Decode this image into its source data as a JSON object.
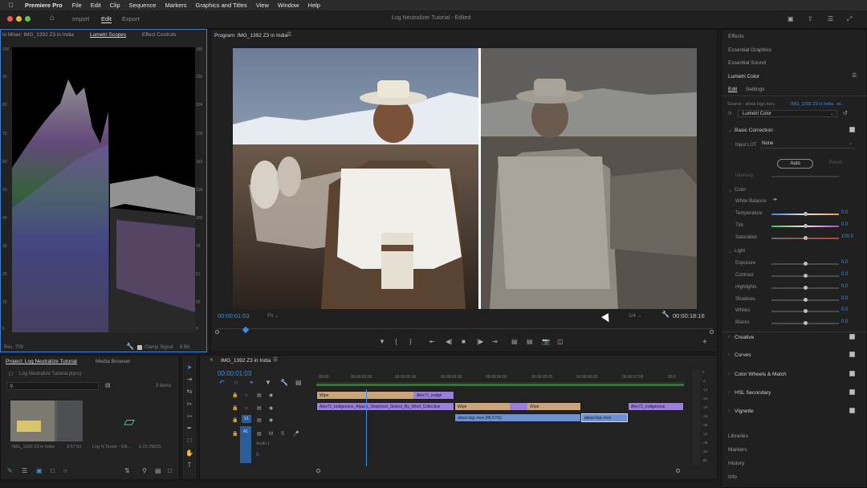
{
  "menubar": {
    "app_name": "Premiere Pro",
    "items": [
      "File",
      "Edit",
      "Clip",
      "Sequence",
      "Markers",
      "Graphics and Titles",
      "View",
      "Window",
      "Help"
    ]
  },
  "titlebar": {
    "nav": [
      "Import",
      "Edit",
      "Export"
    ],
    "title": "Log Neutralizer Tutorial",
    "edited": "- Edited"
  },
  "scopes": {
    "tabs": [
      "io Mixer: IMG_1392 Z3 in India",
      "Lumetri Scopes",
      "Effect Controls"
    ],
    "left_scale": [
      "100",
      "90",
      "80",
      "70",
      "60",
      "50",
      "40",
      "30",
      "20",
      "10",
      "0"
    ],
    "right_scale": [
      "255",
      "230",
      "204",
      "178",
      "153",
      "128",
      "102",
      "76",
      "51",
      "26",
      "0"
    ],
    "footer_left": "Rec. 709",
    "clamp_label": "Clamp Signal",
    "bit_depth": "8 Bit"
  },
  "program": {
    "title": "Program: IMG_1392 Z3 in India",
    "timecode": "00:00:01:03",
    "fit": "Fit",
    "quality": "1/4",
    "duration": "00:00:18:16"
  },
  "project": {
    "tabs": [
      "Project: Log Neutralize Tutorial",
      "Media Browser"
    ],
    "file": "Log Neutralize Tutorial.prproj",
    "items_count": "3 items",
    "clips": [
      {
        "name": "IMG_1392 Z3 in India",
        "duration": "3:57:02"
      },
      {
        "name": "Log N Tester - EN...",
        "duration": "1:01:29620"
      }
    ]
  },
  "timeline": {
    "tab": "IMG_1392 Z3 in India",
    "timecode": "00:00:01:03",
    "ruler": [
      "00:00",
      "00:00:01:00",
      "00:00:02:00",
      "00:00:03:00",
      "00:00:04:00",
      "00:00:05:00",
      "00:00:06:00",
      "00:00:07:00",
      "00:0"
    ],
    "track_labels": [
      "V1",
      "A1"
    ],
    "audio_label": "Audio 1",
    "clips": {
      "wipe1": "Wipe",
      "alex71_top": "Alex71_indige",
      "alex71_main": "Alex71_Indigenous_Alpaca_Shepherd_Sisters_By_Wind_Collective",
      "wipe2": "Wipe",
      "wipe3": "Wipe",
      "alex71_end": "Alex71_indigenous",
      "alexa_log": "alexa logc.mov [46.57%]",
      "alexa_log2": "alexa logc.mov"
    },
    "meter_scale": [
      "0",
      "-6",
      "-12",
      "-18",
      "-24",
      "-30",
      "-36",
      "-42",
      "-48",
      "-54",
      "dB"
    ]
  },
  "right_panel": {
    "sections": [
      "Effects",
      "Essential Graphics",
      "Essential Sound",
      "Lumetri Color"
    ],
    "subtabs": [
      "Edit",
      "Settings"
    ],
    "source": "Source - alexa logc.mov",
    "target": "IMG_1392 Z3 in India - al...",
    "fx_label": "fx",
    "effect_name": "Lumetri Color",
    "basic_correction": "Basic Correction",
    "input_lut_label": "Input LUT",
    "input_lut_value": "None",
    "auto": "Auto",
    "reset": "Reset",
    "intensity": "Intensity",
    "color_group": "Color",
    "white_balance": "White Balance",
    "color_sliders": [
      {
        "label": "Temperature",
        "value": "0.0"
      },
      {
        "label": "Tint",
        "value": "0.0"
      },
      {
        "label": "Saturation",
        "value": "100.0"
      }
    ],
    "light_group": "Light",
    "light_sliders": [
      {
        "label": "Exposure",
        "value": "0.0"
      },
      {
        "label": "Contrast",
        "value": "0.0"
      },
      {
        "label": "Highlights",
        "value": "0.0"
      },
      {
        "label": "Shadows",
        "value": "0.0"
      },
      {
        "label": "Whites",
        "value": "0.0"
      },
      {
        "label": "Blacks",
        "value": "0.0"
      }
    ],
    "collapsed": [
      "Creative",
      "Curves",
      "Color Wheels & Match",
      "HSL Secondary",
      "Vignette"
    ],
    "bottom": [
      "Libraries",
      "Markers",
      "History",
      "Info"
    ]
  },
  "colors": {
    "accent": "#3f8ee6",
    "clip_purple": "#9a7fd6",
    "clip_tan": "#c8a57a",
    "clip_blue": "#6f8fcf",
    "clip_green": "#4aa35a"
  }
}
